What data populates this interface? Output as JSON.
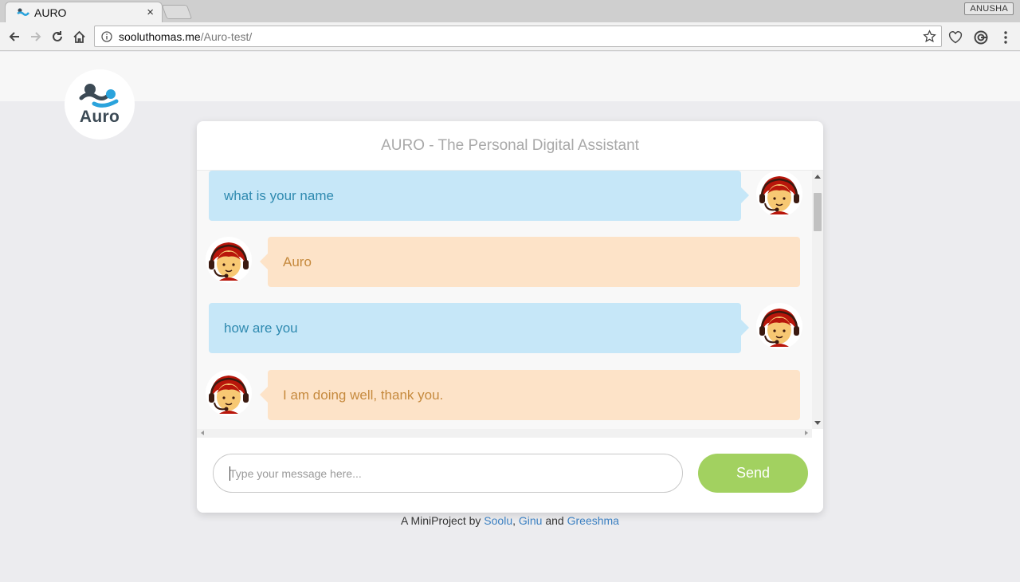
{
  "browser": {
    "tab_title": "AURO",
    "tab_close": "×",
    "profile_name": "ANUSHA",
    "url_host": "sooluthomas.me",
    "url_path": "/Auro-test/"
  },
  "page": {
    "logo_text": "Auro",
    "chat_title": "AURO - The Personal Digital Assistant",
    "messages": [
      {
        "sender": "user",
        "text": "what is your name"
      },
      {
        "sender": "bot",
        "text": "Auro"
      },
      {
        "sender": "user",
        "text": "how are you"
      },
      {
        "sender": "bot",
        "text": "I am doing well, thank you."
      }
    ],
    "input_placeholder": "Type your message here...",
    "send_label": "Send",
    "footer": {
      "prefix": "A MiniProject by ",
      "author1": "Soolu",
      "sep1": ", ",
      "author2": "Ginu",
      "sep2": " and ",
      "author3": "Greeshma"
    }
  },
  "colors": {
    "user_bubble": "#c6e7f8",
    "bot_bubble": "#fde3c8",
    "send_button": "#a2d160",
    "link": "#3a7fc1"
  },
  "icons": [
    "back-arrow-icon",
    "forward-arrow-icon",
    "reload-icon",
    "home-icon",
    "info-icon",
    "star-icon",
    "heart-icon",
    "extension-icon",
    "menu-dots-icon",
    "support-agent-avatar-icon"
  ]
}
